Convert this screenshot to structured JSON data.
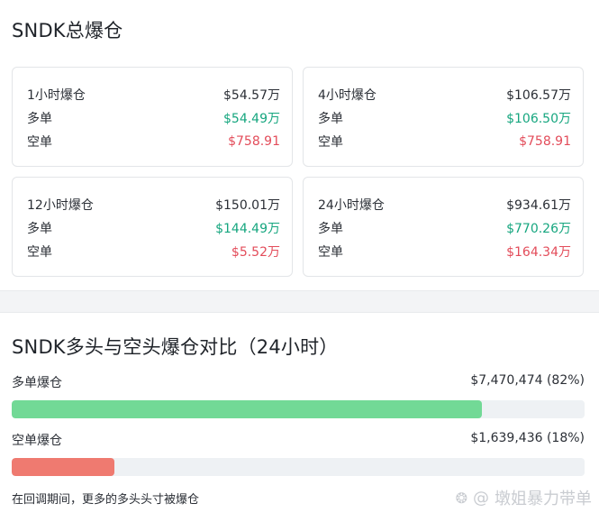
{
  "total": {
    "title": "SNDK总爆仓",
    "cards": [
      {
        "period": "1小时爆仓",
        "total": "$54.57万",
        "long_label": "多单",
        "long": "$54.49万",
        "short_label": "空单",
        "short": "$758.91"
      },
      {
        "period": "4小时爆仓",
        "total": "$106.57万",
        "long_label": "多单",
        "long": "$106.50万",
        "short_label": "空单",
        "short": "$758.91"
      },
      {
        "period": "12小时爆仓",
        "total": "$150.01万",
        "long_label": "多单",
        "long": "$144.49万",
        "short_label": "空单",
        "short": "$5.52万"
      },
      {
        "period": "24小时爆仓",
        "total": "$934.61万",
        "long_label": "多单",
        "long": "$770.26万",
        "short_label": "空单",
        "short": "$164.34万"
      }
    ]
  },
  "compare": {
    "title": "SNDK多头与空头爆仓对比（24小时）",
    "long_label": "多单爆仓",
    "long_value": "$7,470,474 (82%)",
    "long_pct": 82,
    "short_label": "空单爆仓",
    "short_value": "$1,639,436 (18%)",
    "short_pct": 18,
    "note": "在回调期间，更多的多头头寸被爆仓"
  },
  "watermark": {
    "at": "@",
    "text": "墩姐暴力带单"
  },
  "colors": {
    "long": "#16a67f",
    "short": "#e34c5a",
    "long_bar": "#72d996",
    "short_bar": "#ef7a70"
  }
}
